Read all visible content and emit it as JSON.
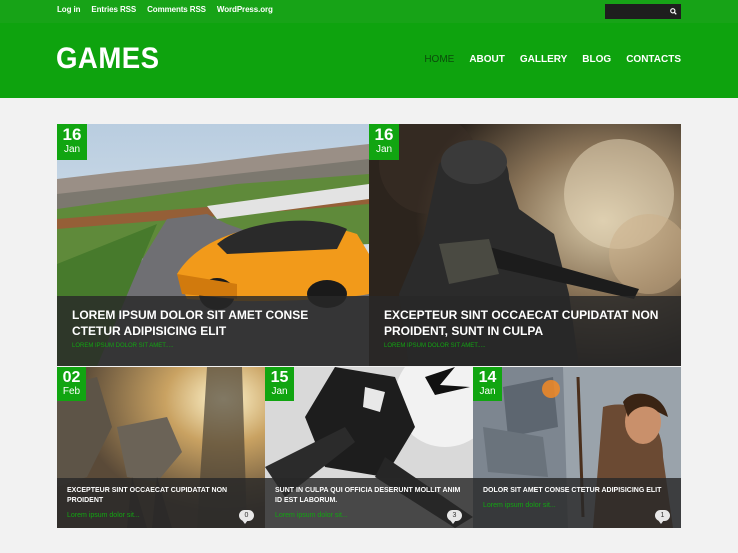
{
  "topbar": {
    "links": [
      "Log in",
      "Entries RSS",
      "Comments RSS",
      "WordPress.org"
    ],
    "search_icon": "search-icon"
  },
  "header": {
    "logo": "GAMES",
    "nav": [
      "HOME",
      "ABOUT",
      "GALLERY",
      "BLOG",
      "CONTACTS"
    ],
    "active_nav": "HOME"
  },
  "posts": [
    {
      "day": "16",
      "month": "Jan",
      "title": "LOREM IPSUM DOLOR SIT AMET CONSE CTETUR ADIPISICING ELIT",
      "excerpt": "LOREM IPSUM DOLOR SIT AMET....."
    },
    {
      "day": "16",
      "month": "Jan",
      "title": "EXCEPTEUR SINT OCCAECAT CUPIDATAT NON PROIDENT, SUNT IN CULPA",
      "excerpt": "LOREM IPSUM DOLOR SIT AMET....."
    },
    {
      "day": "02",
      "month": "Feb",
      "title": "EXCEPTEUR SINT OCCAECAT CUPIDATAT NON PROIDENT",
      "excerpt": "Lorem ipsum dolor sit...",
      "comments": "0"
    },
    {
      "day": "15",
      "month": "Jan",
      "title": "SUNT IN CULPA QUI OFFICIA DESERUNT MOLLIT ANIM ID EST LABORUM.",
      "excerpt": "Lorem ipsum dolor sit...",
      "comments": "3"
    },
    {
      "day": "14",
      "month": "Jan",
      "title": "DOLOR SIT AMET CONSE CTETUR ADIPISICING ELIT",
      "excerpt": "Lorem ipsum dolor sit...",
      "comments": "1"
    }
  ],
  "colors": {
    "brand_green": "#0ea30e",
    "topbar_green": "#17a317",
    "accent": "#11a511"
  }
}
